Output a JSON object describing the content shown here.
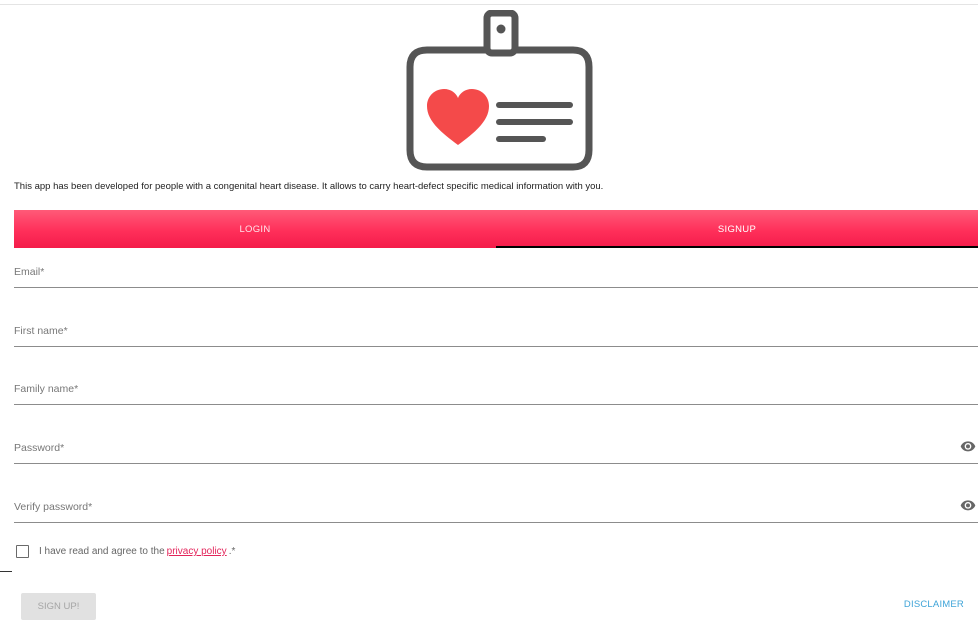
{
  "intro_text": "This app has been developed for people with a congenital heart disease. It allows to carry heart-defect specific medical information with you.",
  "logo": {
    "icon": "id-badge-heart-icon",
    "heart_color": "#f44a4a",
    "stroke_color": "#555555"
  },
  "tabs": [
    {
      "label": "LOGIN",
      "active": false
    },
    {
      "label": "SIGNUP",
      "active": true
    }
  ],
  "tab_bar_color": "#ff2f5a",
  "form": {
    "email": {
      "placeholder": "Email*",
      "value": ""
    },
    "first_name": {
      "placeholder": "First name*",
      "value": ""
    },
    "family_name": {
      "placeholder": "Family name*",
      "value": ""
    },
    "password": {
      "placeholder": "Password*",
      "value": "",
      "icon": "eye-icon"
    },
    "verify_password": {
      "placeholder": "Verify password*",
      "value": "",
      "icon": "eye-icon"
    }
  },
  "agreement": {
    "checked": false,
    "text_before": "I have read and agree to the",
    "link_text": "privacy policy",
    "text_after": ".*"
  },
  "signup_button_label": "SIGN UP!",
  "disclaimer_label": "DISCLAIMER"
}
